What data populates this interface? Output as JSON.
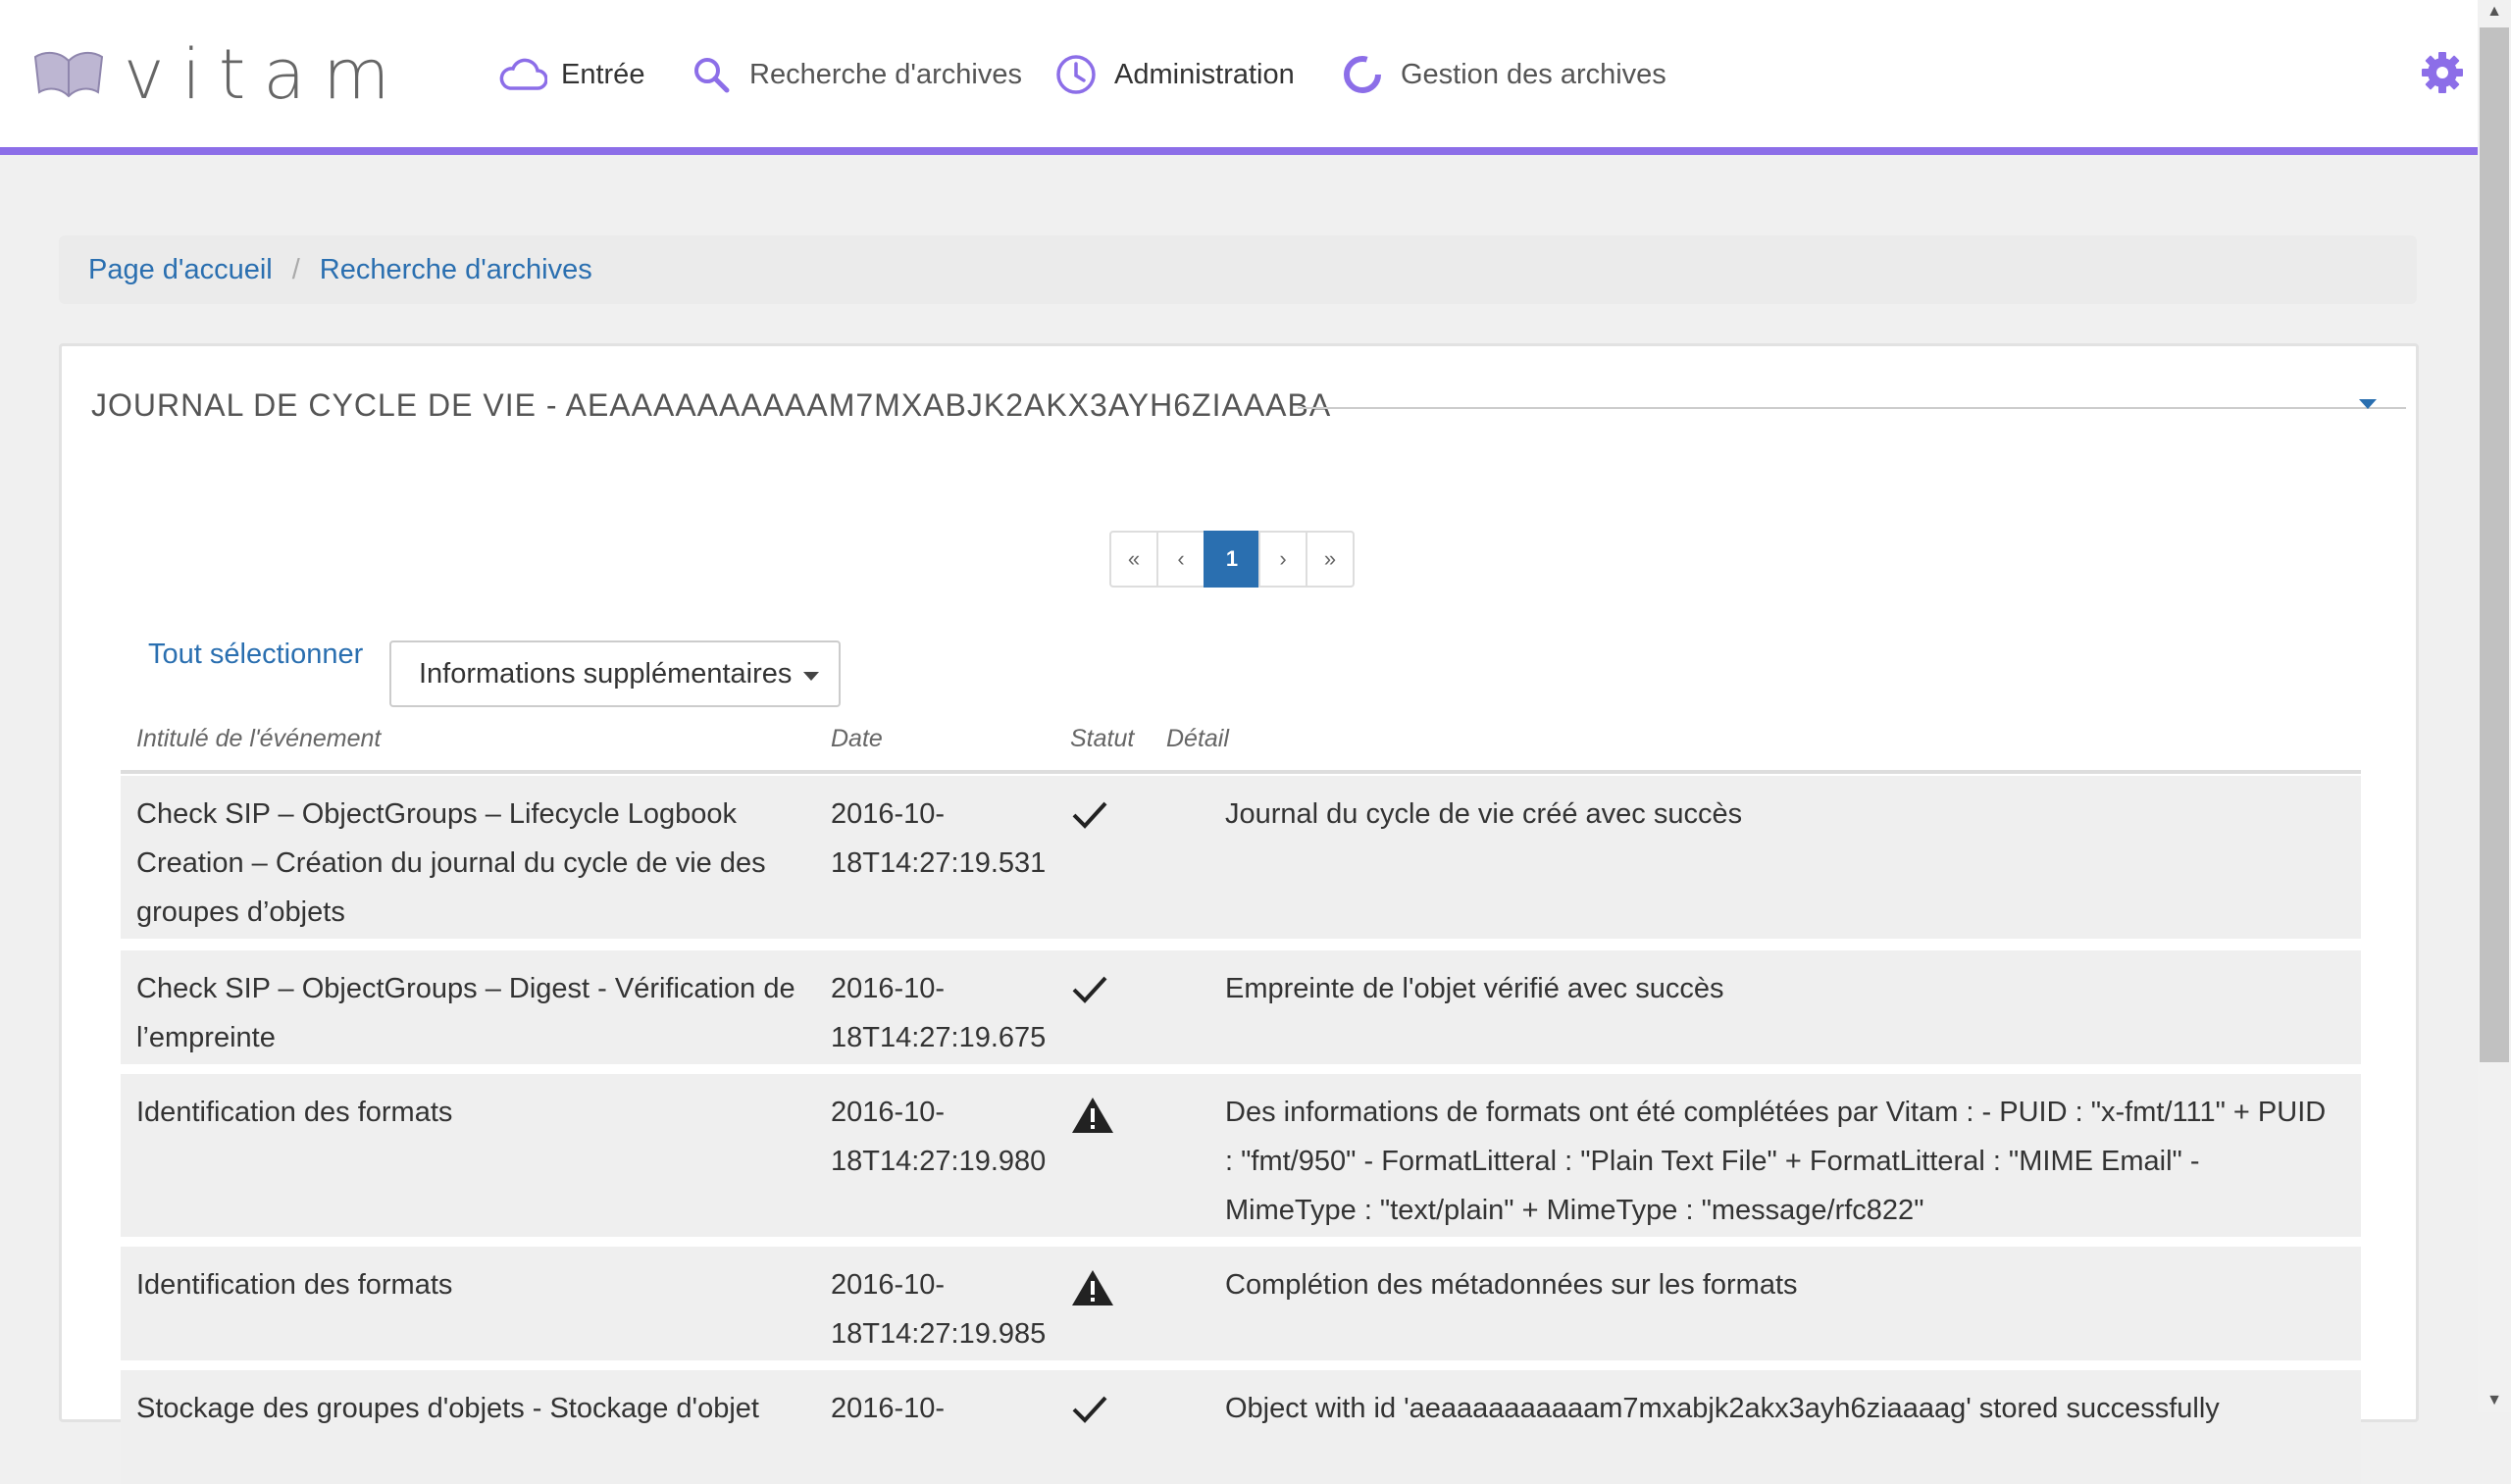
{
  "app": {
    "logo_text": "vitam"
  },
  "nav": [
    {
      "label": "Entrée",
      "icon": "cloud-icon"
    },
    {
      "label": "Recherche d'archives",
      "icon": "search-icon"
    },
    {
      "label": "Administration",
      "icon": "clock-icon"
    },
    {
      "label": "Gestion des archives",
      "icon": "circle-progress-icon"
    }
  ],
  "settings_icon": "gear-icon",
  "breadcrumb": {
    "home": "Page d'accueil",
    "separator": "/",
    "current": "Recherche d'archives"
  },
  "panel": {
    "title": "JOURNAL DE CYCLE DE VIE - AEAAAAAAAAAAM7MXABJK2AKX3AYH6ZIAAABA"
  },
  "pagination": {
    "first": "«",
    "prev": "‹",
    "current": "1",
    "next": "›",
    "last": "»"
  },
  "toolbar": {
    "select_all": "Tout sélectionner",
    "dropdown_label": "Informations supplémentaires"
  },
  "table": {
    "headers": [
      "Intitulé de l'événement",
      "Date",
      "Statut",
      "Détail"
    ],
    "rows": [
      {
        "event": "Check SIP – ObjectGroups – Lifecycle Logbook Creation – Création du journal du cycle de vie des groupes d’objets",
        "date": "2016-10-18T14:27:19.531",
        "status": "ok",
        "detail": "Journal du cycle de vie créé avec succès"
      },
      {
        "event": "Check SIP – ObjectGroups – Digest - Vérification de l’empreinte",
        "date": "2016-10-18T14:27:19.675",
        "status": "ok",
        "detail": "Empreinte de l'objet vérifié avec succès"
      },
      {
        "event": "Identification des formats",
        "date": "2016-10-18T14:27:19.980",
        "status": "warning",
        "detail": "Des informations de formats ont été complétées par Vitam : - PUID : \"x-fmt/111\" + PUID : \"fmt/950\" - FormatLitteral : \"Plain Text File\" + FormatLitteral : \"MIME Email\" - MimeType : \"text/plain\" + MimeType : \"message/rfc822\""
      },
      {
        "event": "Identification des formats",
        "date": "2016-10-18T14:27:19.985",
        "status": "warning",
        "detail": "Complétion des métadonnées sur les formats"
      },
      {
        "event": "Stockage des groupes d'objets - Stockage d'objet",
        "date": "2016-10-",
        "status": "ok",
        "detail": "Object with id 'aeaaaaaaaaaam7mxabjk2akx3ayh6ziaaaag' stored successfully"
      }
    ]
  },
  "colors": {
    "accent": "#8c6ee8",
    "link": "#2a6fb0",
    "row_bg": "#efefef"
  }
}
